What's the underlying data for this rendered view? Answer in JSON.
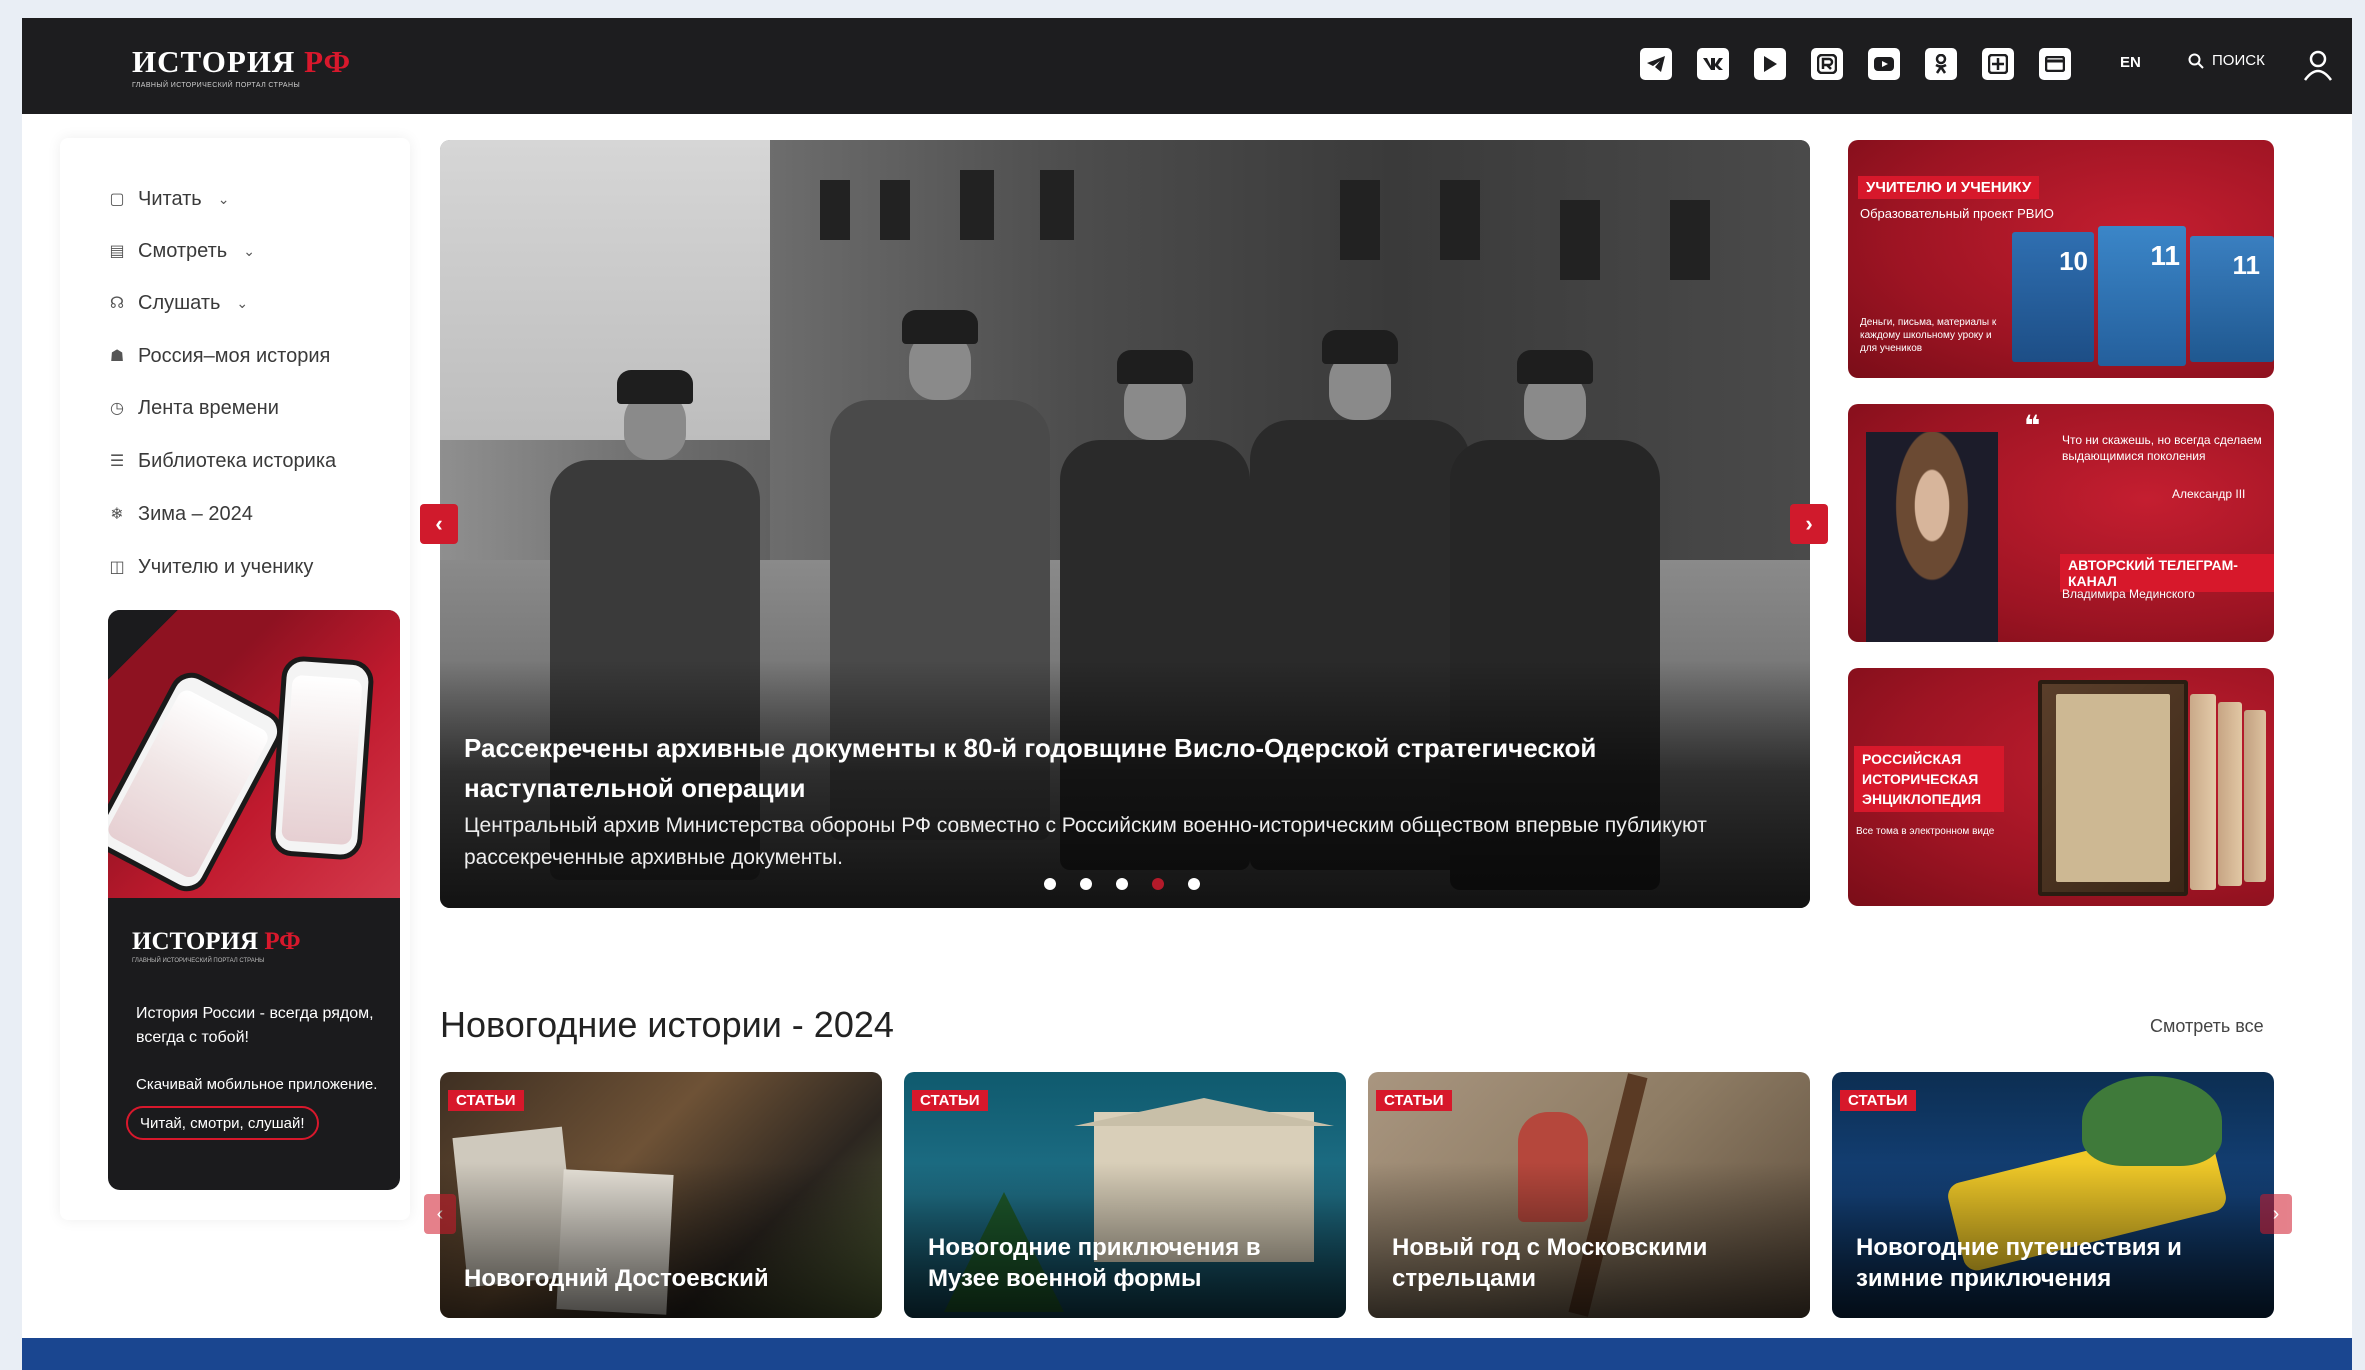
{
  "header": {
    "logo_main": "ИСТОРИЯ",
    "logo_accent": "РФ",
    "logo_sub": "ГЛАВНЫЙ ИСТОРИЧЕСКИЙ ПОРТАЛ СТРАНЫ",
    "social_icons": [
      "telegram-icon",
      "vk-icon",
      "video-icon",
      "rutube-icon",
      "youtube-icon",
      "odnoklassniki-icon",
      "dzen-icon",
      "mail-icon"
    ],
    "lang": "EN",
    "search_label": "ПОИСК"
  },
  "sidebar": {
    "items": [
      {
        "label": "Читать",
        "icon": "book-icon",
        "dropdown": true
      },
      {
        "label": "Смотреть",
        "icon": "film-icon",
        "dropdown": true
      },
      {
        "label": "Слушать",
        "icon": "headphones-icon",
        "dropdown": true
      },
      {
        "label": "Россия–моя история",
        "icon": "russia-icon",
        "dropdown": false
      },
      {
        "label": "Лента времени",
        "icon": "clock-icon",
        "dropdown": false
      },
      {
        "label": "Библиотека историка",
        "icon": "library-icon",
        "dropdown": false
      },
      {
        "label": "Зима – 2024",
        "icon": "snowflake-icon",
        "dropdown": false
      },
      {
        "label": "Учителю и ученику",
        "icon": "open-book-icon",
        "dropdown": false
      }
    ],
    "promo": {
      "logo_main": "ИСТОРИЯ",
      "logo_accent": "РФ",
      "logo_sub": "ГЛАВНЫЙ ИСТОРИЧЕСКИЙ ПОРТАЛ СТРАНЫ",
      "text": "История России - всегда рядом, всегда с тобой!",
      "download": "Скачивай мобильное приложение.",
      "button": "Читай, смотри, слушай!"
    }
  },
  "hero": {
    "title": "Рассекречены архивные документы к 80-й годовщине Висло-Одерской стратегической наступательной операции",
    "description": "Центральный архив Министерства обороны РФ совместно с Российским военно-историческим обществом впервые публикуют рассекреченные архивные документы.",
    "slide_count": 5,
    "active_slide": 4
  },
  "banners": [
    {
      "tag": "УЧИТЕЛЮ И УЧЕНИКУ",
      "subtitle": "Образовательный проект РВИО",
      "text": "Деньги, письма, материалы к каждому школьному уроку и для учеников",
      "books": [
        "10",
        "11",
        "11"
      ]
    },
    {
      "quote": "Что ни скажешь, но всегда сделаем выдающимися поколения",
      "author": "Александр III",
      "tag": "АВТОРСКИЙ ТЕЛЕГРАМ-КАНАЛ",
      "name": "Владимира Мединского"
    },
    {
      "tag": "РОССИЙСКАЯ ИСТОРИЧЕСКАЯ ЭНЦИКЛОПЕДИЯ",
      "text": "Все тома в электронном виде"
    }
  ],
  "section": {
    "title": "Новогодние истории - 2024",
    "see_all": "Смотреть все",
    "cards": [
      {
        "badge": "СТАТЬИ",
        "title": "Новогодний Достоевский"
      },
      {
        "badge": "СТАТЬИ",
        "title": "Новогодние приключения в Музее военной формы"
      },
      {
        "badge": "СТАТЬИ",
        "title": "Новый год с Московскими стрельцами"
      },
      {
        "badge": "СТАТЬИ",
        "title": "Новогодние путешествия и зимние приключения"
      }
    ]
  },
  "colors": {
    "accent": "#d8182c",
    "header_bg": "#1d1d1f",
    "footer_bar": "#1a4690"
  }
}
